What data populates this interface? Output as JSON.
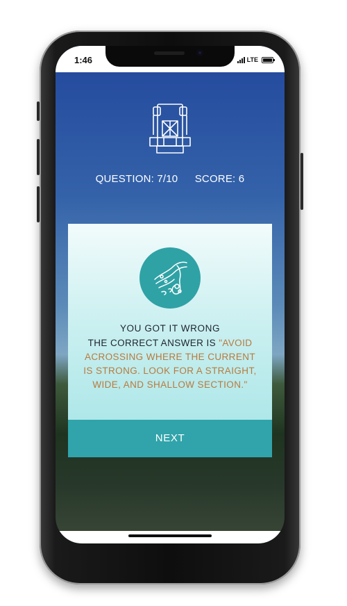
{
  "status_bar": {
    "time": "1:46",
    "network": "LTE"
  },
  "quiz": {
    "question_label": "QUESTION: 7/10",
    "score_label": "SCORE: 6"
  },
  "result": {
    "title": "YOU GOT IT WRONG",
    "prefix": "THE CORRECT ANSWER IS ",
    "answer": "\"AVOID ACROSSING WHERE THE CURRENT IS STRONG. LOOK FOR A STRAIGHT, WIDE, AND SHALLOW SECTION.\""
  },
  "next_label": "NEXT",
  "icons": {
    "header": "backpack-icon",
    "result": "river-crossing-icon"
  },
  "colors": {
    "accent": "#30a4aa",
    "answer_text": "#b87a3c",
    "sky_top": "#22479c"
  }
}
